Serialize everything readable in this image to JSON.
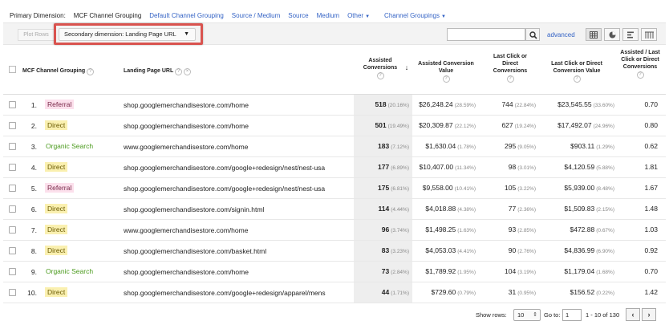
{
  "primary_dimension": {
    "label": "Primary Dimension:",
    "options": [
      {
        "label": "MCF Channel Grouping",
        "active": true
      },
      {
        "label": "Default Channel Grouping",
        "active": false
      },
      {
        "label": "Source / Medium",
        "active": false
      },
      {
        "label": "Source",
        "active": false
      },
      {
        "label": "Medium",
        "active": false
      },
      {
        "label": "Other",
        "active": false
      },
      {
        "label": "Channel Groupings",
        "active": false
      }
    ]
  },
  "toolbar": {
    "plot_rows": "Plot Rows",
    "secondary_dimension": "Secondary dimension: Landing Page URL",
    "search_placeholder": "",
    "advanced": "advanced",
    "view_icons": [
      "table-view-icon",
      "pie-view-icon",
      "performance-view-icon",
      "pivot-view-icon"
    ]
  },
  "table": {
    "headers": {
      "channel": "MCF Channel Grouping",
      "landing": "Landing Page URL",
      "assisted": "Assisted Conversions",
      "assisted_value": "Assisted Conversion Value",
      "last_click": "Last Click or Direct Conversions",
      "last_click_value": "Last Click or Direct Conversion Value",
      "ratio": "Assisted / Last Click or Direct Conversions"
    },
    "rows": [
      {
        "num": "1.",
        "channel": "Referral",
        "type": "referral",
        "url": "shop.googlemerchandisestore.com/home",
        "assisted": "518",
        "assisted_pct": "(20.16%)",
        "assisted_value": "$26,248.24",
        "assisted_value_pct": "(28.59%)",
        "last_click": "744",
        "last_click_pct": "(22.84%)",
        "last_click_value": "$23,545.55",
        "last_click_value_pct": "(33.60%)",
        "ratio": "0.70"
      },
      {
        "num": "2.",
        "channel": "Direct",
        "type": "direct",
        "url": "shop.googlemerchandisestore.com/home",
        "assisted": "501",
        "assisted_pct": "(19.49%)",
        "assisted_value": "$20,309.87",
        "assisted_value_pct": "(22.12%)",
        "last_click": "627",
        "last_click_pct": "(19.24%)",
        "last_click_value": "$17,492.07",
        "last_click_value_pct": "(24.96%)",
        "ratio": "0.80"
      },
      {
        "num": "3.",
        "channel": "Organic Search",
        "type": "organic",
        "url": "www.googlemerchandisestore.com/home",
        "assisted": "183",
        "assisted_pct": "(7.12%)",
        "assisted_value": "$1,630.04",
        "assisted_value_pct": "(1.78%)",
        "last_click": "295",
        "last_click_pct": "(9.05%)",
        "last_click_value": "$903.11",
        "last_click_value_pct": "(1.29%)",
        "ratio": "0.62"
      },
      {
        "num": "4.",
        "channel": "Direct",
        "type": "direct",
        "url": "shop.googlemerchandisestore.com/google+redesign/nest/nest-usa",
        "assisted": "177",
        "assisted_pct": "(6.89%)",
        "assisted_value": "$10,407.00",
        "assisted_value_pct": "(11.34%)",
        "last_click": "98",
        "last_click_pct": "(3.01%)",
        "last_click_value": "$4,120.59",
        "last_click_value_pct": "(5.88%)",
        "ratio": "1.81"
      },
      {
        "num": "5.",
        "channel": "Referral",
        "type": "referral",
        "url": "shop.googlemerchandisestore.com/google+redesign/nest/nest-usa",
        "assisted": "175",
        "assisted_pct": "(6.81%)",
        "assisted_value": "$9,558.00",
        "assisted_value_pct": "(10.41%)",
        "last_click": "105",
        "last_click_pct": "(3.22%)",
        "last_click_value": "$5,939.00",
        "last_click_value_pct": "(8.48%)",
        "ratio": "1.67"
      },
      {
        "num": "6.",
        "channel": "Direct",
        "type": "direct",
        "url": "shop.googlemerchandisestore.com/signin.html",
        "assisted": "114",
        "assisted_pct": "(4.44%)",
        "assisted_value": "$4,018.88",
        "assisted_value_pct": "(4.38%)",
        "last_click": "77",
        "last_click_pct": "(2.36%)",
        "last_click_value": "$1,509.83",
        "last_click_value_pct": "(2.15%)",
        "ratio": "1.48"
      },
      {
        "num": "7.",
        "channel": "Direct",
        "type": "direct",
        "url": "www.googlemerchandisestore.com/home",
        "assisted": "96",
        "assisted_pct": "(3.74%)",
        "assisted_value": "$1,498.25",
        "assisted_value_pct": "(1.63%)",
        "last_click": "93",
        "last_click_pct": "(2.85%)",
        "last_click_value": "$472.88",
        "last_click_value_pct": "(0.67%)",
        "ratio": "1.03"
      },
      {
        "num": "8.",
        "channel": "Direct",
        "type": "direct",
        "url": "shop.googlemerchandisestore.com/basket.html",
        "assisted": "83",
        "assisted_pct": "(3.23%)",
        "assisted_value": "$4,053.03",
        "assisted_value_pct": "(4.41%)",
        "last_click": "90",
        "last_click_pct": "(2.76%)",
        "last_click_value": "$4,836.99",
        "last_click_value_pct": "(6.90%)",
        "ratio": "0.92"
      },
      {
        "num": "9.",
        "channel": "Organic Search",
        "type": "organic",
        "url": "shop.googlemerchandisestore.com/home",
        "assisted": "73",
        "assisted_pct": "(2.84%)",
        "assisted_value": "$1,789.92",
        "assisted_value_pct": "(1.95%)",
        "last_click": "104",
        "last_click_pct": "(3.19%)",
        "last_click_value": "$1,179.04",
        "last_click_value_pct": "(1.68%)",
        "ratio": "0.70"
      },
      {
        "num": "10.",
        "channel": "Direct",
        "type": "direct",
        "url": "shop.googlemerchandisestore.com/google+redesign/apparel/mens",
        "assisted": "44",
        "assisted_pct": "(1.71%)",
        "assisted_value": "$729.60",
        "assisted_value_pct": "(0.79%)",
        "last_click": "31",
        "last_click_pct": "(0.95%)",
        "last_click_value": "$156.52",
        "last_click_value_pct": "(0.22%)",
        "ratio": "1.42"
      }
    ]
  },
  "pagination": {
    "show_rows_label": "Show rows:",
    "show_rows_value": "10",
    "goto_label": "Go to:",
    "goto_value": "1",
    "range": "1 - 10 of 130"
  }
}
